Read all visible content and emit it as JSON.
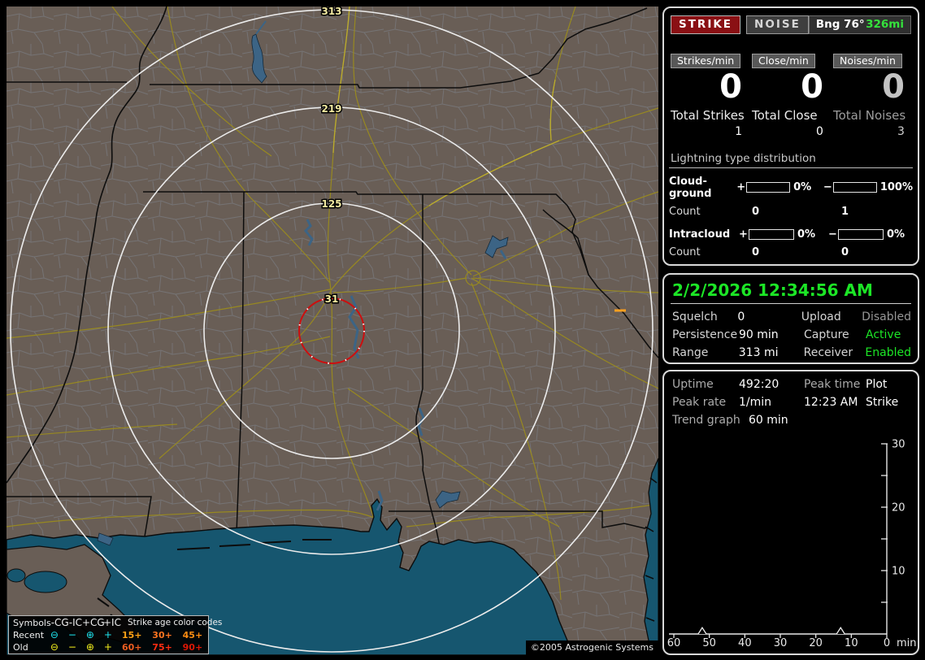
{
  "colors": {
    "status_green": "#1ce626",
    "distance_green": "#35e23c",
    "strike_button_red": "#8a1014",
    "alarm_ring_red": "#cc0f0f",
    "cg_bar_blue": "#9cc4e8",
    "map_land": "#695e56",
    "map_water": "#16566f",
    "ring_label_yellow": "#f2e9a0"
  },
  "header": {
    "strike_button": "STRIKE",
    "noise_button": "NOISE",
    "bearing": "Bng 76°",
    "distance": "326mi"
  },
  "counters": [
    {
      "label": "Strikes/min",
      "value": "0",
      "total_label": "Total Strikes",
      "total_value": "1"
    },
    {
      "label": "Close/min",
      "value": "0",
      "total_label": "Total Close",
      "total_value": "0"
    },
    {
      "label": "Noises/min",
      "value": "0",
      "total_label": "Total Noises",
      "total_value": "3"
    }
  ],
  "distribution": {
    "title": "Lightning type distribution",
    "rows": [
      {
        "label": "Cloud-ground",
        "plus_sign": "+",
        "plus_pct": "0%",
        "plus_fill": 0,
        "minus_sign": "−",
        "minus_pct": "100%",
        "minus_fill": 100,
        "count_label": "Count",
        "plus_count": "0",
        "minus_count": "1"
      },
      {
        "label": "Intracloud",
        "plus_sign": "+",
        "plus_pct": "0%",
        "plus_fill": 0,
        "minus_sign": "−",
        "minus_pct": "0%",
        "minus_fill": 0,
        "count_label": "Count",
        "plus_count": "0",
        "minus_count": "0"
      }
    ]
  },
  "status": {
    "datetime": "2/2/2026 12:34:56 AM",
    "rows": [
      {
        "label1": "Squelch",
        "value1": "0",
        "label2": "Upload",
        "value2": "Disabled",
        "state2": "gray"
      },
      {
        "label1": "Persistence",
        "value1": "90 min",
        "label2": "Capture",
        "value2": "Active",
        "state2": "green"
      },
      {
        "label1": "Range",
        "value1": "313 mi",
        "label2": "Receiver",
        "value2": "Enabled",
        "state2": "green"
      }
    ]
  },
  "stats": {
    "rows": [
      {
        "label1": "Uptime",
        "value1": "492:20",
        "label2": "Peak time",
        "value2": "Plot"
      },
      {
        "label1": "Peak rate",
        "value1": "1/min",
        "label2": "12:23 AM",
        "value2": "Strike"
      }
    ],
    "trend_label": "Trend graph",
    "trend_value": "60 min"
  },
  "chart_data": {
    "type": "line",
    "title": "Strike rate trend, last 60 minutes",
    "x_unit": "min",
    "x_ticks": [
      60,
      50,
      40,
      30,
      20,
      10,
      0
    ],
    "x_range": [
      60,
      0
    ],
    "ylim": [
      0,
      30
    ],
    "y_ticks": [
      30,
      25,
      20,
      15,
      10,
      5
    ],
    "y_labeled_ticks": [
      30,
      20,
      10
    ],
    "grid": false,
    "legend_position": "none",
    "series": [
      {
        "name": "Strike",
        "baseline_value": 0,
        "spikes": [
          {
            "min_ago": 52,
            "value": 1
          },
          {
            "min_ago": 13,
            "value": 1
          }
        ]
      }
    ]
  },
  "map": {
    "ring_labels": {
      "r31": "31",
      "r125": "125",
      "r219": "219",
      "r313": "313"
    },
    "copyright": "©2005 Astrogenic Systems",
    "legend": {
      "header": {
        "c0": "Symbols",
        "c1": "-CG",
        "c2": "-IC",
        "c3": "+CG",
        "c4": "+IC",
        "age_title": "Strike age color codes"
      },
      "rows": [
        {
          "label": "Recent",
          "symbols": [
            "⊖",
            "−",
            "⊕",
            "+"
          ],
          "ages": [
            {
              "text": "15+",
              "color": "#ffa216"
            },
            {
              "text": "30+",
              "color": "#ff7420"
            },
            {
              "text": "45+",
              "color": "#ff8d12"
            }
          ]
        },
        {
          "label": "Old",
          "symbols": [
            "⊖",
            "−",
            "⊕",
            "+"
          ],
          "ages": [
            {
              "text": "60+",
              "color": "#ef5d20"
            },
            {
              "text": "75+",
              "color": "#ff2d12"
            },
            {
              "text": "90+",
              "color": "#dd1806"
            }
          ]
        }
      ]
    }
  }
}
